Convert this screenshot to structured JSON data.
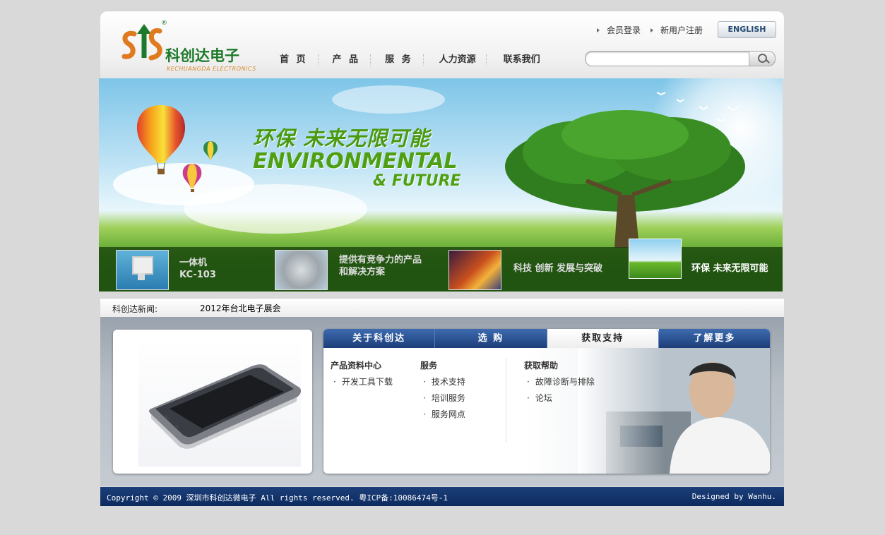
{
  "header": {
    "logo_cn": "科创达电子",
    "logo_en": "KECHUANGDA ELECTRONICS",
    "logo_reg": "®",
    "links": {
      "login": "会员登录",
      "register": "新用户注册"
    },
    "english_button": "ENGLISH",
    "nav": [
      "首 页",
      "产 品",
      "服 务",
      "人力资源",
      "联系我们"
    ],
    "search": {
      "value": "",
      "placeholder": ""
    }
  },
  "banner": {
    "headline_cn": "环保 未来无限可能",
    "headline_en1": "ENVIRONMENTAL",
    "headline_en2": "& FUTURE",
    "thumbs": [
      {
        "label": "一体机\nKC-103",
        "line1": "一体机",
        "line2": "KC-103"
      },
      {
        "line1": "提供有竞争力的产品",
        "line2": "和解决方案"
      },
      {
        "line1": "科技 创新 发展与突破",
        "line2": ""
      },
      {
        "line1": "环保 未来无限可能",
        "line2": ""
      }
    ]
  },
  "news": {
    "label": "科创达新闻:",
    "item": "2012年台北电子展会"
  },
  "tabs": {
    "items": [
      "关于科创达",
      "选 购",
      "获取支持",
      "了解更多"
    ],
    "active_index": 2,
    "columns": [
      {
        "title": "产品资料中心",
        "items": [
          "开发工具下载"
        ]
      },
      {
        "title": "服务",
        "items": [
          "技术支持",
          "培训服务",
          "服务网点"
        ]
      },
      {
        "title": "获取帮助",
        "items": [
          "故障诊断与排除",
          "论坛"
        ]
      }
    ]
  },
  "footer": {
    "copyright": "Copyright © 2009 深圳市科创达微电子 All rights reserved. 粤ICP备:10086474号-1",
    "designed": "Designed by Wanhu."
  },
  "colors": {
    "brand_green": "#1d7a2a",
    "nav_blue": "#1d3e78",
    "logo_orange": "#d98a2b"
  }
}
